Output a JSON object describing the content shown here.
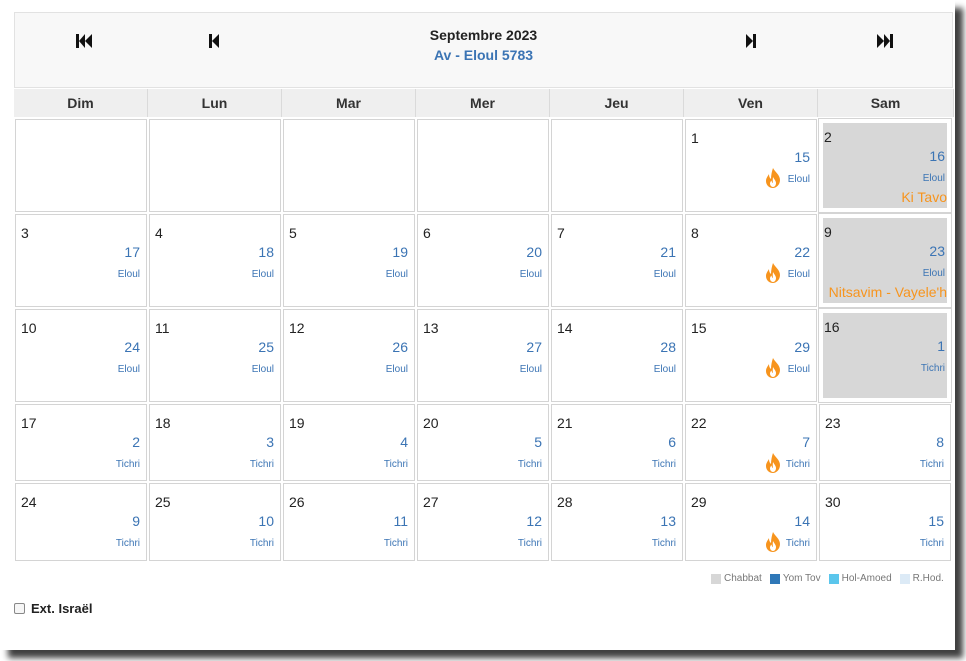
{
  "header": {
    "title": "Septembre 2023",
    "subtitle": "Av - Eloul 5783"
  },
  "weekdays": [
    "Dim",
    "Lun",
    "Mar",
    "Mer",
    "Jeu",
    "Ven",
    "Sam"
  ],
  "weeks": [
    [
      null,
      null,
      null,
      null,
      null,
      {
        "g": "1",
        "h": "15",
        "m": "Eloul",
        "flame": true
      },
      {
        "g": "2",
        "h": "16",
        "m": "Eloul",
        "shabbat": true,
        "parasha": "Ki Tavo"
      }
    ],
    [
      {
        "g": "3",
        "h": "17",
        "m": "Eloul"
      },
      {
        "g": "4",
        "h": "18",
        "m": "Eloul"
      },
      {
        "g": "5",
        "h": "19",
        "m": "Eloul"
      },
      {
        "g": "6",
        "h": "20",
        "m": "Eloul"
      },
      {
        "g": "7",
        "h": "21",
        "m": "Eloul"
      },
      {
        "g": "8",
        "h": "22",
        "m": "Eloul",
        "flame": true
      },
      {
        "g": "9",
        "h": "23",
        "m": "Eloul",
        "shabbat": true,
        "parasha": "Nitsavim - Vayele'h"
      }
    ],
    [
      {
        "g": "10",
        "h": "24",
        "m": "Eloul"
      },
      {
        "g": "11",
        "h": "25",
        "m": "Eloul"
      },
      {
        "g": "12",
        "h": "26",
        "m": "Eloul"
      },
      {
        "g": "13",
        "h": "27",
        "m": "Eloul"
      },
      {
        "g": "14",
        "h": "28",
        "m": "Eloul"
      },
      {
        "g": "15",
        "h": "29",
        "m": "Eloul",
        "flame": true
      },
      {
        "g": "16",
        "h": "1",
        "m": "Tichri",
        "shabbat": true
      }
    ],
    [
      {
        "g": "17",
        "h": "2",
        "m": "Tichri"
      },
      {
        "g": "18",
        "h": "3",
        "m": "Tichri"
      },
      {
        "g": "19",
        "h": "4",
        "m": "Tichri"
      },
      {
        "g": "20",
        "h": "5",
        "m": "Tichri"
      },
      {
        "g": "21",
        "h": "6",
        "m": "Tichri"
      },
      {
        "g": "22",
        "h": "7",
        "m": "Tichri",
        "flame": true
      },
      {
        "g": "23",
        "h": "8",
        "m": "Tichri"
      }
    ],
    [
      {
        "g": "24",
        "h": "9",
        "m": "Tichri"
      },
      {
        "g": "25",
        "h": "10",
        "m": "Tichri"
      },
      {
        "g": "26",
        "h": "11",
        "m": "Tichri"
      },
      {
        "g": "27",
        "h": "12",
        "m": "Tichri"
      },
      {
        "g": "28",
        "h": "13",
        "m": "Tichri"
      },
      {
        "g": "29",
        "h": "14",
        "m": "Tichri",
        "flame": true
      },
      {
        "g": "30",
        "h": "15",
        "m": "Tichri"
      }
    ]
  ],
  "legend": [
    {
      "label": "Chabbat",
      "color": "#d7d7d7"
    },
    {
      "label": "Yom Tov",
      "color": "#2f78b8"
    },
    {
      "label": "Hol-Amoed",
      "color": "#5bc6ec"
    },
    {
      "label": "R.Hod.",
      "color": "#dceaf6"
    }
  ],
  "ext_israel": {
    "label": "Ext. Israël",
    "checked": false
  },
  "icons": {
    "first": "skip-to-first-icon",
    "prev": "step-backward-icon",
    "next": "step-forward-icon",
    "last": "skip-to-last-icon",
    "candle": "flame-icon"
  },
  "colors": {
    "hebrew": "#3b74b4",
    "parasha": "#f7941d",
    "shabbat_bg": "#d7d7d7"
  }
}
